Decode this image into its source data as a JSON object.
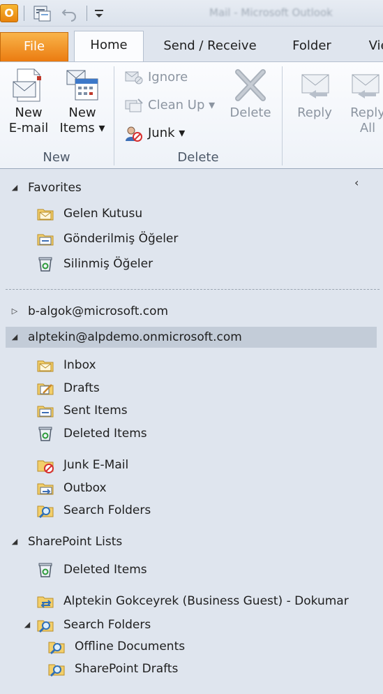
{
  "quick_access": {
    "logo_letter": "O",
    "window_title": "Mail - Microsoft Outlook"
  },
  "tabs": [
    {
      "label": "File"
    },
    {
      "label": "Home"
    },
    {
      "label": "Send / Receive"
    },
    {
      "label": "Folder"
    },
    {
      "label": "View"
    }
  ],
  "ribbon": {
    "new_email": [
      "New",
      "E-mail"
    ],
    "new_items": [
      "New",
      "Items ▾"
    ],
    "ignore": "Ignore",
    "clean_up": "Clean Up ▾",
    "junk": "Junk ▾",
    "delete": "Delete",
    "reply": "Reply",
    "reply_all": [
      "Reply",
      "All"
    ],
    "group_new": "New",
    "group_delete": "Delete"
  },
  "nav": {
    "favorites": {
      "label": "Favorites",
      "items": [
        "Gelen Kutusu",
        "Gönderilmiş Öğeler",
        "Silinmiş Öğeler"
      ]
    },
    "account1": "b-algok@microsoft.com",
    "account2": {
      "label": "alptekin@alpdemo.onmicrosoft.com",
      "items": [
        "Inbox",
        "Drafts",
        "Sent Items",
        "Deleted Items",
        "Junk E-Mail",
        "Outbox",
        "Search Folders"
      ]
    },
    "sharepoint": {
      "label": "SharePoint Lists",
      "items": [
        "Deleted Items",
        "Alptekin Gokceyrek (Business Guest) - Dokumar",
        "Search Folders",
        "Offline Documents",
        "SharePoint Drafts"
      ]
    }
  },
  "colors": {
    "file_tab": "#eb7b10",
    "pane_bg": "#dfe5ee",
    "selected_row": "#c3ccd8",
    "folder_yellow": "#f3cf6a"
  }
}
